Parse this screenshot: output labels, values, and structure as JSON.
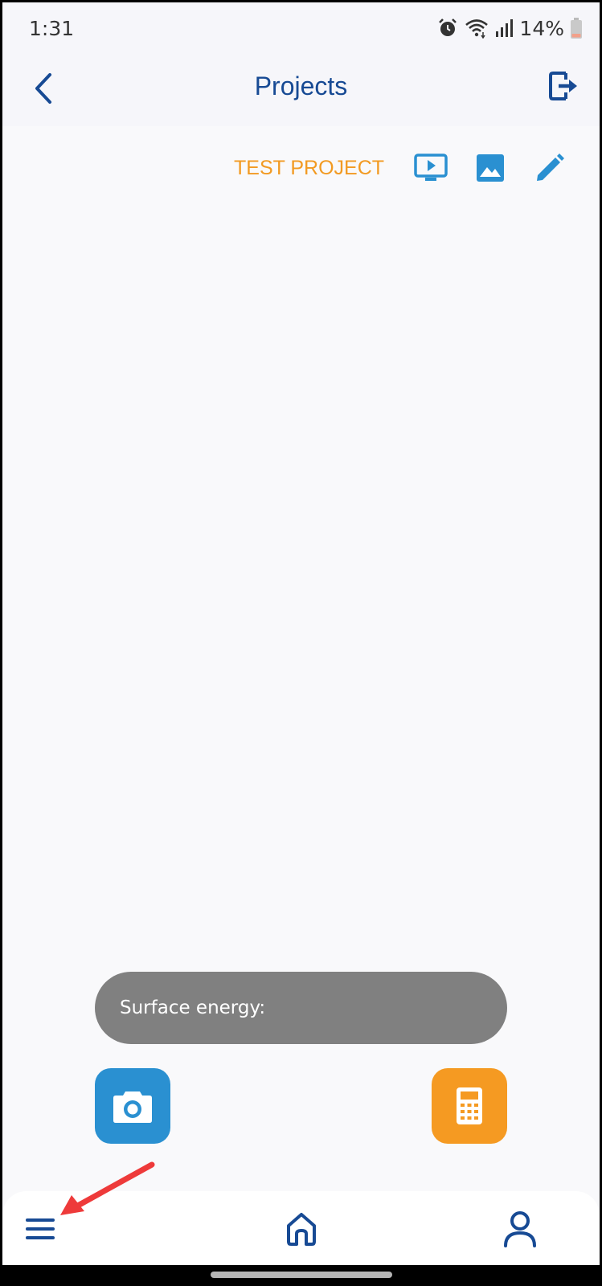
{
  "status_bar": {
    "time": "1:31",
    "battery_percent": "14%",
    "icons": [
      "alarm-icon",
      "wifi-icon",
      "signal-icon",
      "battery-icon"
    ]
  },
  "app_bar": {
    "title": "Projects",
    "back_icon": "chevron-left-icon",
    "logout_icon": "logout-icon"
  },
  "project": {
    "name": "TEST PROJECT",
    "actions": [
      "play-video-icon",
      "image-icon",
      "edit-pencil-icon"
    ]
  },
  "toast": {
    "text": "Surface energy:"
  },
  "fabs": {
    "camera_icon": "camera-icon",
    "calculator_icon": "calculator-icon"
  },
  "bottom_nav": {
    "items": [
      "menu-icon",
      "home-icon",
      "profile-icon"
    ]
  },
  "colors": {
    "primary_dark_blue": "#174a94",
    "accent_blue": "#2a90d1",
    "accent_orange": "#f59a22",
    "toast_gray": "#808080",
    "annotation_red": "#ee3a3a"
  }
}
